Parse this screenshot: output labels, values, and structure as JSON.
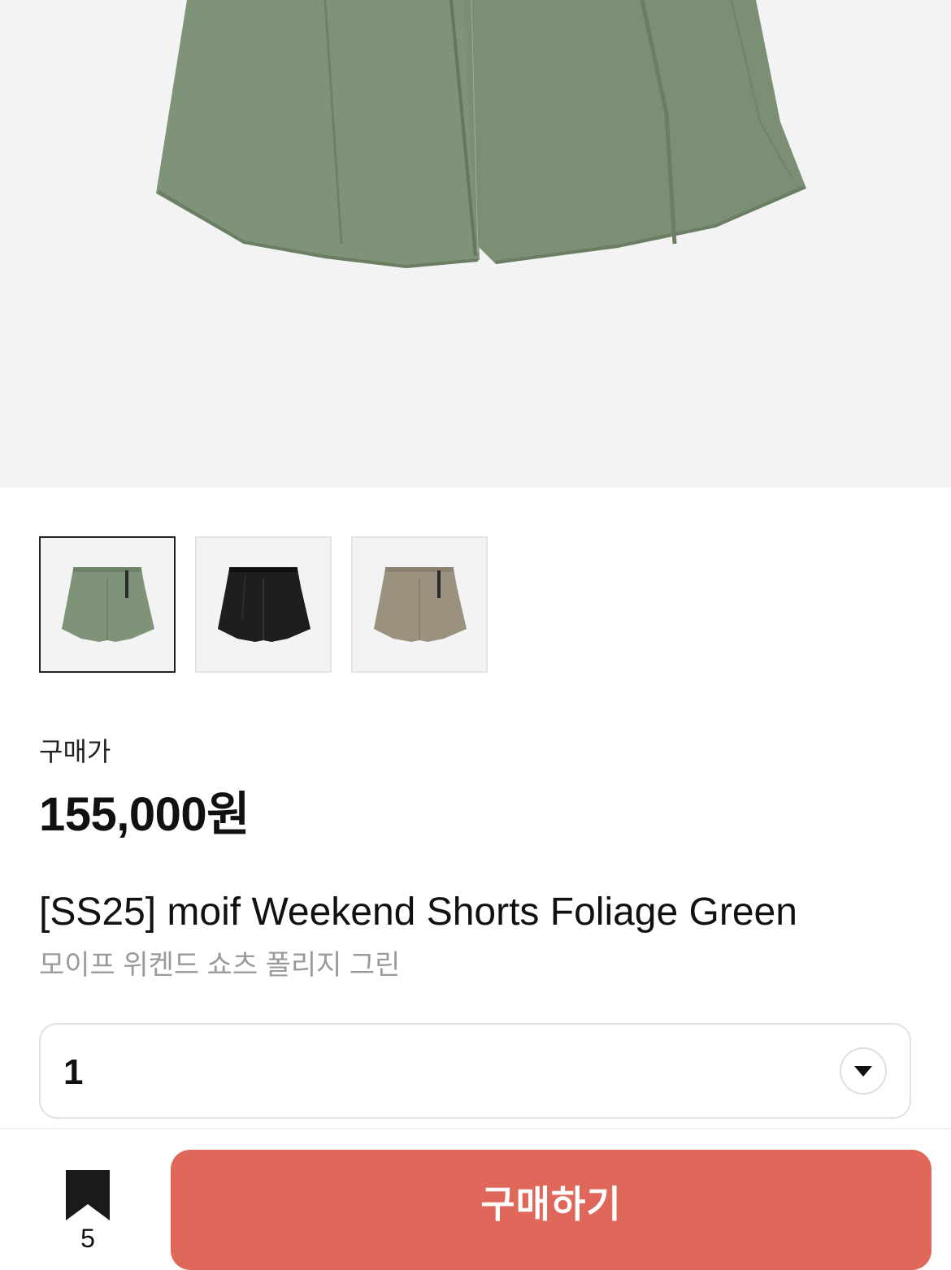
{
  "product": {
    "main_image": "foliage-green-shorts-photo",
    "thumbnails": [
      {
        "name": "shorts-foliage-green-thumbnail",
        "color": "#7f9379",
        "selected": true
      },
      {
        "name": "shorts-black-thumbnail",
        "color": "#1e1e1e",
        "selected": false
      },
      {
        "name": "shorts-khaki-thumbnail",
        "color": "#9a927e",
        "selected": false
      }
    ],
    "price_label": "구매가",
    "price": "155,000원",
    "name_en": "[SS25] moif Weekend Shorts Foliage Green",
    "name_ko": "모이프 위켄드 쇼츠 폴리지 그린"
  },
  "quantity_select": {
    "value": "1",
    "icon": "chevron-down-icon"
  },
  "bottom_bar": {
    "bookmark_icon": "bookmark-icon",
    "bookmark_count": "5",
    "buy_label": "구매하기",
    "buy_color": "#e0685a"
  }
}
